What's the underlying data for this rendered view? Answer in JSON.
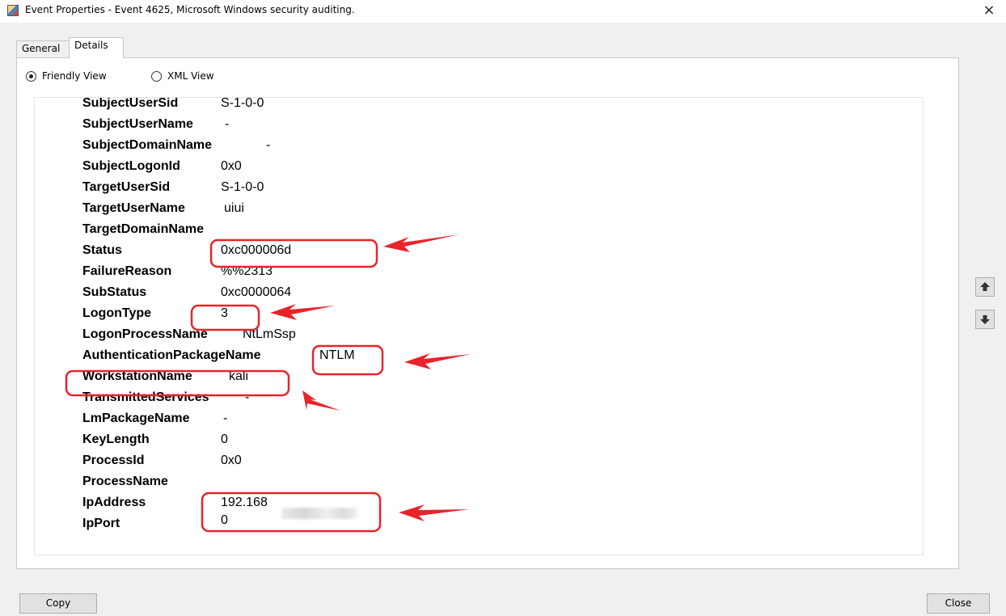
{
  "window": {
    "title": "Event Properties - Event 4625, Microsoft Windows security auditing.",
    "close_glyph": "×",
    "app_icon": "event-viewer-icon"
  },
  "tabs": [
    {
      "label": "General",
      "active": false
    },
    {
      "label": "Details",
      "active": true
    }
  ],
  "view_options": {
    "friendly": {
      "label": "Friendly View",
      "selected": true
    },
    "xml": {
      "label": "XML View",
      "selected": false
    }
  },
  "details": [
    {
      "name": "SubjectUserSid",
      "value": "S-1-0-0"
    },
    {
      "name": "SubjectUserName",
      "value": "-"
    },
    {
      "name": "SubjectDomainName",
      "value": "-"
    },
    {
      "name": "SubjectLogonId",
      "value": "0x0"
    },
    {
      "name": "TargetUserSid",
      "value": "S-1-0-0"
    },
    {
      "name": "TargetUserName",
      "value": "uiui"
    },
    {
      "name": "TargetDomainName",
      "value": ""
    },
    {
      "name": "Status",
      "value": "0xc000006d"
    },
    {
      "name": "FailureReason",
      "value": "%%2313"
    },
    {
      "name": "SubStatus",
      "value": "0xc0000064"
    },
    {
      "name": "LogonType",
      "value": "3"
    },
    {
      "name": "LogonProcessName",
      "value": "NtLmSsp"
    },
    {
      "name": "AuthenticationPackageName",
      "value": "NTLM"
    },
    {
      "name": "WorkstationName",
      "value": "kali"
    },
    {
      "name": "TransmittedServices",
      "value": "-"
    },
    {
      "name": "LmPackageName",
      "value": "-"
    },
    {
      "name": "KeyLength",
      "value": "0"
    },
    {
      "name": "ProcessId",
      "value": "0x0"
    },
    {
      "name": "ProcessName",
      "value": ""
    },
    {
      "name": "IpAddress",
      "value": "192.168"
    },
    {
      "name": "IpPort",
      "value": "0"
    }
  ],
  "buttons": {
    "copy": "Copy",
    "close": "Close"
  },
  "icons": {
    "scroll_up": "chevron-up-icon",
    "scroll_down": "chevron-down-icon",
    "nav_up": "arrow-up-icon",
    "nav_down": "arrow-down-icon"
  },
  "annotation_color": "#e8232a"
}
